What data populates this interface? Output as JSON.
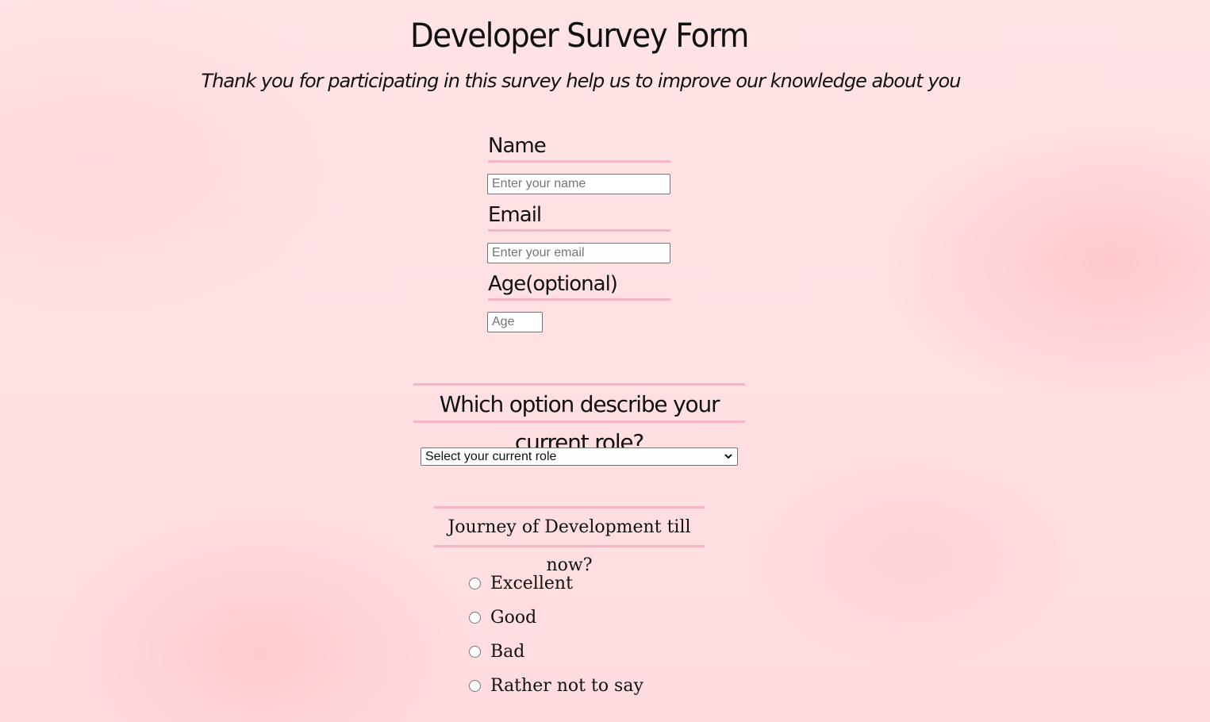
{
  "header": {
    "title": "Developer Survey Form",
    "subtitle": "Thank you for participating in this survey help us to improve our knowledge about you"
  },
  "form": {
    "name": {
      "label": "Name",
      "placeholder": "Enter your name",
      "value": ""
    },
    "email": {
      "label": "Email",
      "placeholder": "Enter your email",
      "value": ""
    },
    "age": {
      "label": "Age(optional)",
      "placeholder": "Age",
      "value": ""
    },
    "role": {
      "question": "Which option describe your current role?",
      "selected": "Select your current role"
    },
    "journey": {
      "question": "Journey of Development till now?",
      "options": [
        {
          "label": "Excellent",
          "checked": false
        },
        {
          "label": "Good",
          "checked": false
        },
        {
          "label": "Bad",
          "checked": false
        },
        {
          "label": "Rather not to say",
          "checked": false
        }
      ]
    }
  },
  "icons": {
    "select_arrow": "chevron-down-icon"
  },
  "colors": {
    "accent_border": "#f5b6c2",
    "background": "#ffe0e3"
  }
}
